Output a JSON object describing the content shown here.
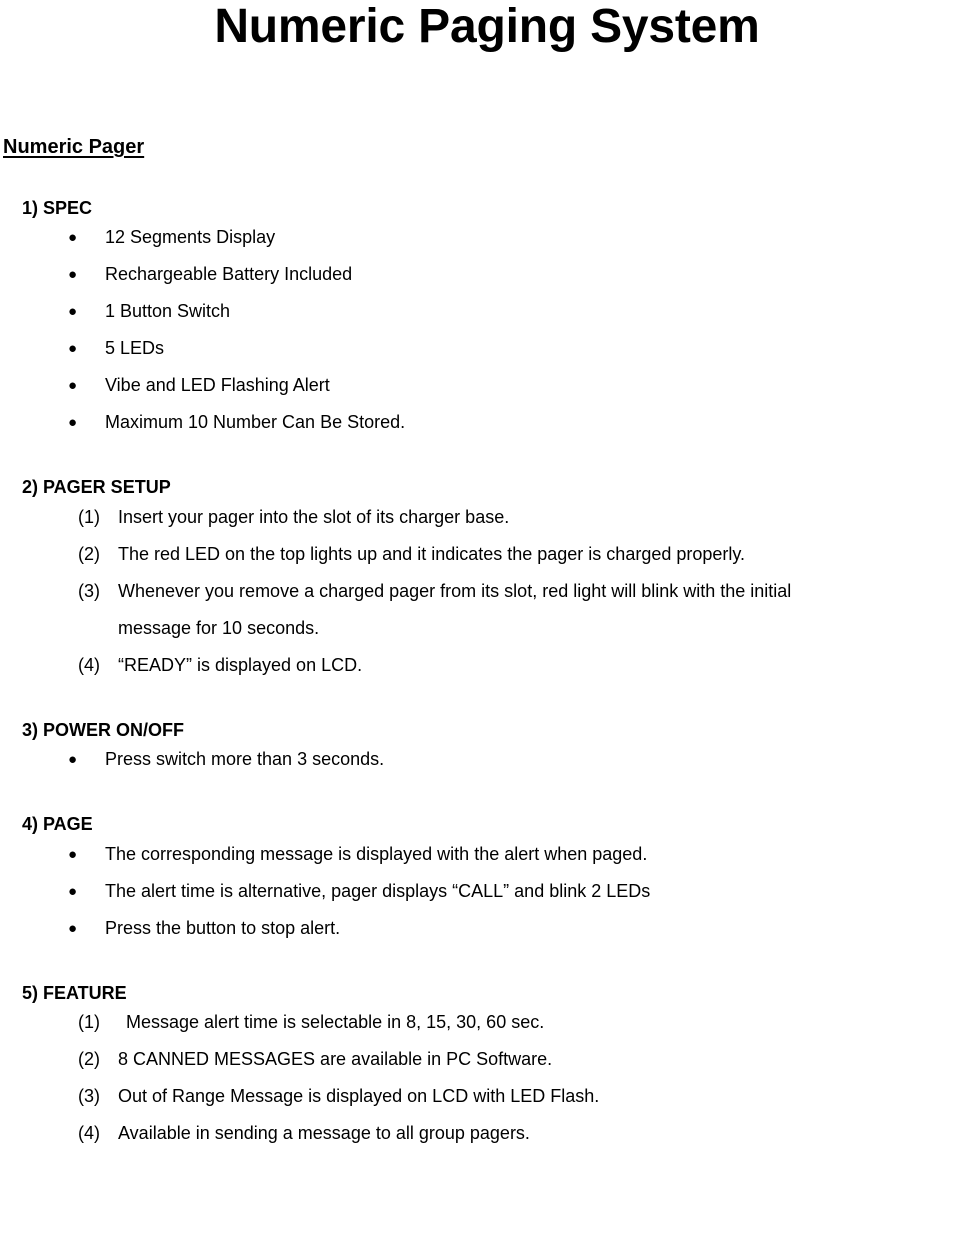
{
  "document": {
    "title": "Numeric Paging System",
    "section_heading": "Numeric Pager",
    "bullet_glyph": "●"
  },
  "sections": [
    {
      "heading": "1) SPEC",
      "list_type": "bullet",
      "items": [
        "12 Segments Display",
        "Rechargeable Battery Included",
        "1 Button Switch",
        "5 LEDs",
        "Vibe and LED Flashing Alert",
        "Maximum 10 Number Can Be Stored."
      ]
    },
    {
      "heading": "2) PAGER SETUP",
      "list_type": "numbered",
      "items": [
        {
          "marker": "(1)",
          "text": "Insert your pager into the slot of its charger base."
        },
        {
          "marker": "(2)",
          "text": "The red LED on the top lights up and it indicates the pager is charged properly."
        },
        {
          "marker": "(3)",
          "text": "Whenever you remove a charged pager from its slot, red light will blink with the initial",
          "continuation": "message for 10 seconds."
        },
        {
          "marker": "(4)",
          "text": "“READY” is displayed on LCD."
        }
      ]
    },
    {
      "heading": "3) POWER ON/OFF",
      "list_type": "bullet",
      "items": [
        "Press switch more than 3 seconds."
      ]
    },
    {
      "heading": "4) PAGE",
      "list_type": "bullet",
      "items": [
        "The corresponding message is displayed with the alert when paged.",
        "The alert time is alternative, pager displays “CALL” and blink 2 LEDs",
        "Press the button to stop alert."
      ]
    },
    {
      "heading": "5) FEATURE",
      "list_type": "numbered",
      "items": [
        {
          "marker": "(1)",
          "text": "Message alert time is selectable in 8, 15, 30, 60 sec.",
          "wide_gap": true
        },
        {
          "marker": "(2)",
          "text": "8 CANNED MESSAGES are available in PC Software."
        },
        {
          "marker": "(3)",
          "text": "Out of Range Message is displayed on LCD with LED Flash."
        },
        {
          "marker": "(4)",
          "text": "Available in sending a message to all group pagers."
        }
      ]
    }
  ]
}
